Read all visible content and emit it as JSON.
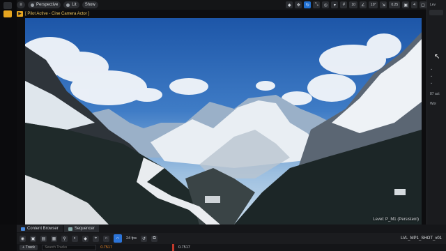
{
  "toolbar": {
    "perspective_label": "Perspective",
    "lit_label": "Lit",
    "show_label": "Show",
    "grid_value": "10",
    "angle_value": "10°",
    "scale_value": "0.25",
    "camera_speed": "4"
  },
  "pilot": {
    "label": "[ Pilot Active - Cine Camera Actor ]"
  },
  "viewport": {
    "level_label": "Level: P_M1 (Persistent)"
  },
  "right_panel": {
    "line1": "Lev",
    "line2": "87 act",
    "line3": "Wor"
  },
  "bottom": {
    "tabs": [
      {
        "label": "Content Browser"
      },
      {
        "label": "Sequencer"
      }
    ],
    "fps": "24 fps",
    "shot_name": "LVL_MP1_SHOT_v01",
    "add_track": "+ Track",
    "search_placeholder": "Search Tracks",
    "time_left": "0.7517",
    "time_right": "0.7517"
  },
  "colors": {
    "accent": "#1f6fd1",
    "pilot_yellow": "#e8c15a",
    "sky": "#3f7cc6"
  }
}
